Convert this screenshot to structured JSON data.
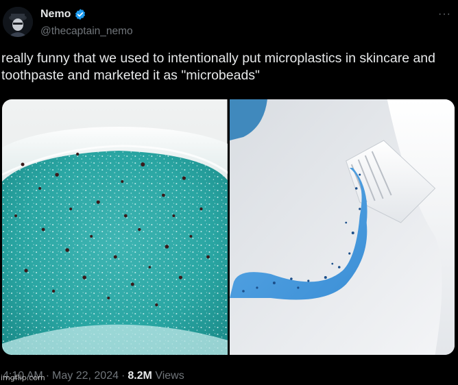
{
  "tweet": {
    "author_name": "Nemo",
    "handle": "@thecaptain_nemo",
    "text": "really funny that we used to intentionally put microplastics in skincare and toothpaste and marketed it as \"microbeads\"",
    "time": "4:10 AM",
    "date": "May 22, 2024",
    "views_count": "8.2M",
    "views_label": "Views",
    "more_icon": "more-icon",
    "verified_icon": "verified-badge-icon",
    "verified_color": "#1d9bf0"
  },
  "media": {
    "images": [
      {
        "name": "microbeads-in-gel-photo"
      },
      {
        "name": "toothpaste-with-microbeads-photo"
      }
    ]
  },
  "watermark": {
    "text": "imgflip.com"
  }
}
